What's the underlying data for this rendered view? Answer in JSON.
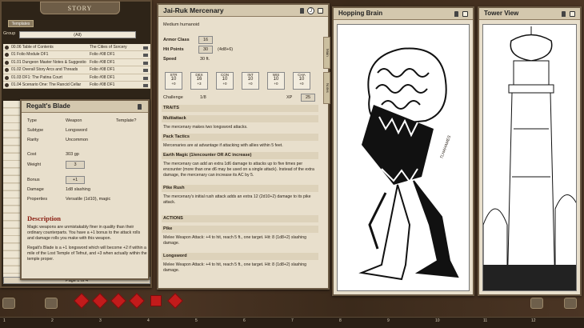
{
  "story": {
    "title": "STORY",
    "templates_label": "Templates",
    "group_label": "Group",
    "group_value": "(All)",
    "entries": [
      {
        "name": "00.06 Table of Contents",
        "source": "The Cities of Sorcery"
      },
      {
        "name": "01 Folio Module DF1",
        "source": "Folio #08 DF1"
      },
      {
        "name": "01.01 Dungeon Master Notes & Suggestio",
        "source": "Folio #08 DF1"
      },
      {
        "name": "01.02 Overall Story Arcs and Threads",
        "source": "Folio #08 DF1"
      },
      {
        "name": "01.03 DF1: The Patina Court",
        "source": "Folio #08 DF1"
      },
      {
        "name": "01.04 Scenario One: The Rancid Cellar",
        "source": "Folio #08 DF1"
      }
    ],
    "page_indicator": "Page 1 of 4"
  },
  "item": {
    "title": "Regalt's Blade",
    "type_label": "Type",
    "type_value": "Weapon",
    "template_label": "Template?",
    "subtype_label": "Subtype",
    "subtype_value": "Longsword",
    "rarity_label": "Rarity",
    "rarity_value": "Uncommon",
    "cost_label": "Cost",
    "cost_value": "303 gp",
    "weight_label": "Weight",
    "weight_value": "3",
    "bonus_label": "Bonus",
    "bonus_value": "+1",
    "damage_label": "Damage",
    "damage_value": "1d8 slashing",
    "properties_label": "Properties",
    "properties_value": "Versatile (1d10), magic",
    "description_heading": "Description",
    "description_1": "Magic weapons are unmistakably finer in quality than their ordinary counterparts. You have a +1 bonus to the attack rolls and damage rolls you make with this weapon.",
    "description_2": "Regalt's Blade is a +1 longsword which will become +2 if within a mile of the Lost Temple of Tefnut, and +3 when actually within the temple proper."
  },
  "npc": {
    "title": "Jai-Ruk Mercenary",
    "subtitle": "Medium humanoid",
    "ac_label": "Armor Class",
    "ac_value": "16",
    "hp_label": "Hit Points",
    "hp_value": "30",
    "hp_formula": "(4d8+6)",
    "speed_label": "Speed",
    "speed_value": "30 ft.",
    "abilities": [
      {
        "name": "STR",
        "score": "10",
        "mod": "+0"
      },
      {
        "name": "DEX",
        "score": "16",
        "mod": "+3"
      },
      {
        "name": "CON",
        "score": "10",
        "mod": "+0"
      },
      {
        "name": "INT",
        "score": "10",
        "mod": "+0"
      },
      {
        "name": "WIS",
        "score": "10",
        "mod": "+0"
      },
      {
        "name": "CHA",
        "score": "10",
        "mod": "+0"
      }
    ],
    "challenge_label": "Challenge",
    "challenge_value": "1/8",
    "xp_label": "XP",
    "xp_value": "25",
    "traits_heading": "TRAITS",
    "traits": [
      {
        "name": "Multiattack",
        "text": "The mercenary makes two longsword attacks."
      },
      {
        "name": "Pack Tactics",
        "text": "Mercenaries are at advantage if attacking with allies within 5 feet."
      },
      {
        "name": "Earth Magic (1/encounter OR AC increase)",
        "text": "The mercenary can add an extra 1d6 damage to attacks up to five times per encounter (more than one d6 may be used on a single attack). Instead of the extra damage, the mercenary can increase its AC by 5."
      },
      {
        "name": "Pike Rush",
        "text": "The mercenary's initial rush attack adds an extra 12 (2d10+2) damage to its pike attack."
      }
    ],
    "actions_heading": "ACTIONS",
    "actions": [
      {
        "name": "Pike",
        "text": "Melee Weapon Attack: +4 to hit, reach 5 ft., one target. Hit: 8 (1d8+2) slashing damage."
      },
      {
        "name": "Longsword",
        "text": "Melee Weapon Attack: +4 to hit, reach 5 ft., one target. Hit: 8 (1d8+2) slashing damage."
      }
    ],
    "side_tab_1": "Main",
    "side_tab_2": "Notes"
  },
  "image_brain": {
    "title": "Hopping Brain",
    "signature": "TLHAHAMES"
  },
  "image_tower": {
    "title": "Tower View"
  },
  "hotkeys": [
    "1",
    "2",
    "3",
    "4",
    "5",
    "6",
    "7",
    "8",
    "9",
    "10",
    "11",
    "12"
  ]
}
